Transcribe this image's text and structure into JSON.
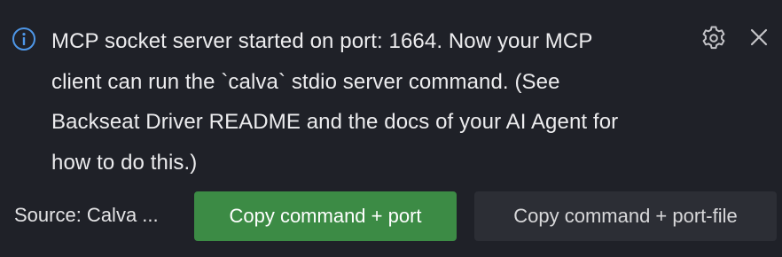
{
  "notification": {
    "message": "MCP socket server started on port: 1664. Now your MCP\nclient can run the `calva` stdio server command. (See\nBackseat Driver README and the docs of your AI Agent for\nhow to do this.)",
    "icon": "info-icon",
    "source": "Source: Calva ...",
    "actions": {
      "primary_label": "Copy command + port",
      "secondary_label": "Copy command + port-file"
    },
    "controls": {
      "settings_icon": "gear-icon",
      "close_icon": "close-icon"
    }
  },
  "colors": {
    "background": "#1f2128",
    "primary_button": "#3c8b45",
    "secondary_button": "#2c2e35",
    "info_icon": "#4e97e8"
  }
}
